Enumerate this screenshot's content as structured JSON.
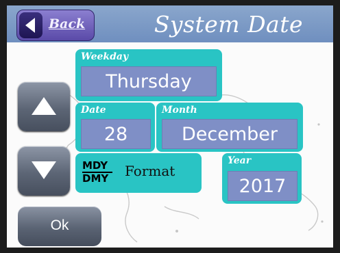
{
  "header": {
    "title": "System Date",
    "back_label": "Back"
  },
  "weekday": {
    "label": "Weekday",
    "value": "Thursday"
  },
  "date": {
    "label": "Date",
    "value": "28"
  },
  "month": {
    "label": "Month",
    "value": "December"
  },
  "year": {
    "label": "Year",
    "value": "2017"
  },
  "format": {
    "label": "Format",
    "icon_top": "MDY",
    "icon_bottom": "DMY"
  },
  "buttons": {
    "ok_label": "Ok"
  },
  "colors": {
    "header": "#7f9bc6",
    "panel": "#29c4c4",
    "value_box": "#7f8fc6",
    "back_button": "#6e5fbe"
  }
}
